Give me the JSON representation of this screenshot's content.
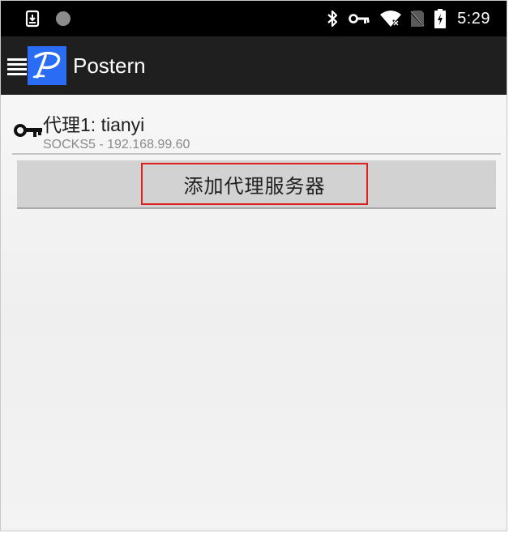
{
  "status_bar": {
    "time": "5:29",
    "icons": [
      "download-icon",
      "circle-indicator-icon",
      "bluetooth-icon",
      "vpn-key-icon",
      "wifi-icon",
      "no-sim-icon",
      "battery-charging-icon"
    ]
  },
  "app_bar": {
    "title": "Postern",
    "icons": [
      "menu-icon",
      "postern-logo-icon"
    ]
  },
  "proxy_list": [
    {
      "title": "代理1: tianyi",
      "subtitle": "SOCKS5 - 192.168.99.60",
      "icon": "key-icon"
    }
  ],
  "add_button": {
    "label": "添加代理服务器"
  },
  "colors": {
    "status_bar": "#000000",
    "app_bar": "#1f1f1f",
    "logo_bg": "#2a6df4",
    "button_bg": "#d2d2d2",
    "highlight": "#e02020"
  }
}
